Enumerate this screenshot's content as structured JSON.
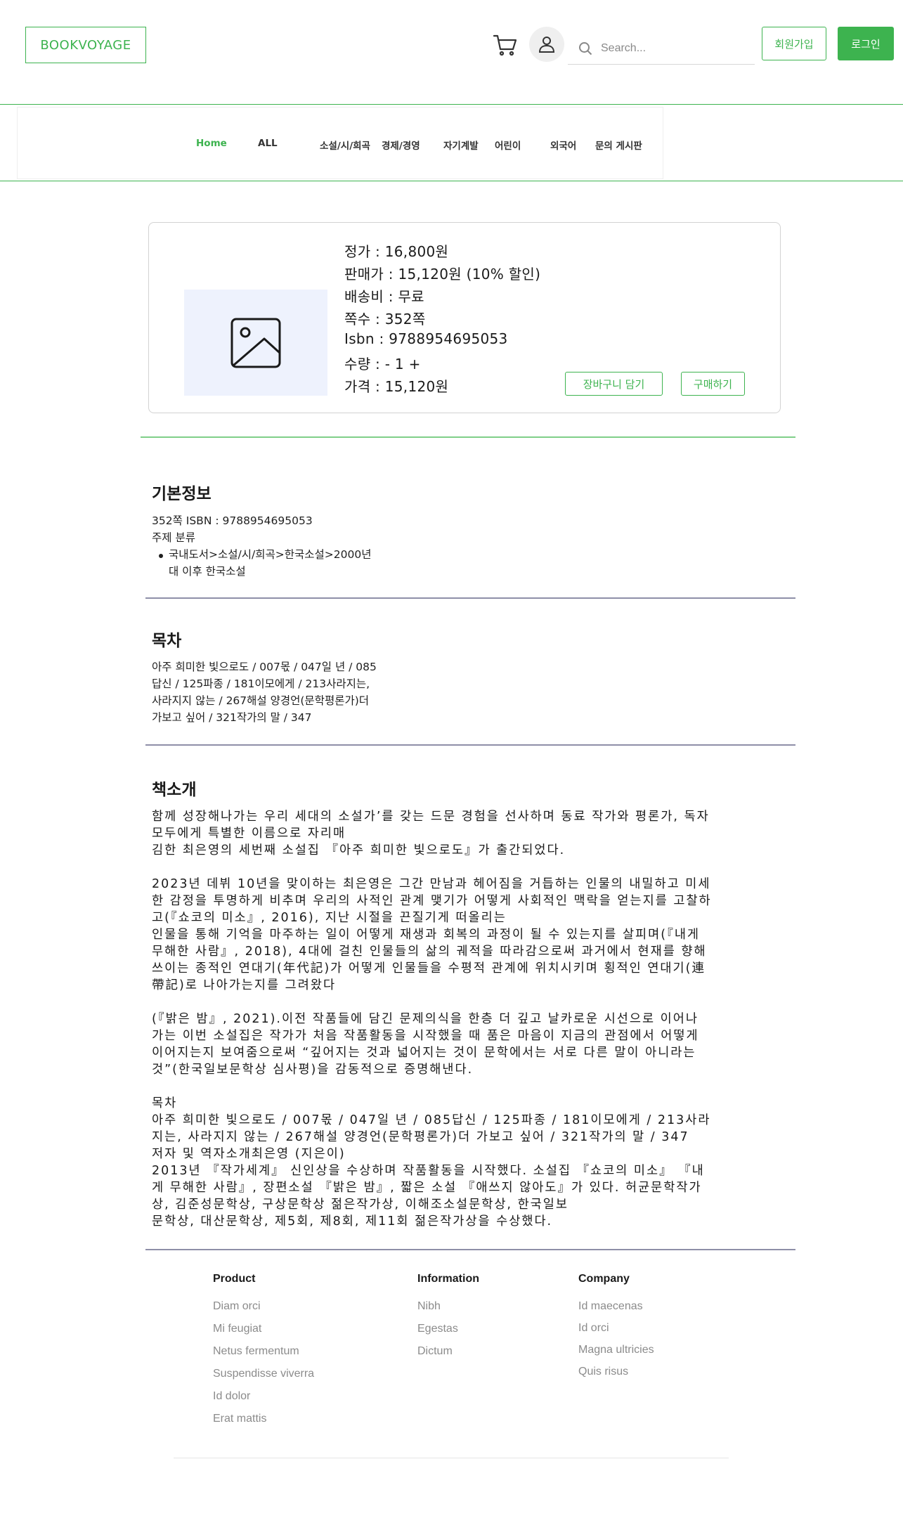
{
  "header": {
    "logo": "BOOKVOYAGE",
    "search_placeholder": "Search...",
    "signup_label": "회원가입",
    "login_label": "로그인",
    "accent": "#3db34f"
  },
  "nav": {
    "items": [
      "Home",
      "ALL",
      "소설/시/희곡",
      "경제/경영",
      "자기계발",
      "어린이",
      "외국어",
      "문의 게시판"
    ]
  },
  "product": {
    "lines": [
      "정가 : 16,800원",
      "판매가 : 15,120원 (10% 할인)",
      "배송비 : 무료",
      "쪽수 : 352쪽",
      "Isbn : 9788954695053",
      "수량 : - 1 +",
      "가격 : 15,120원"
    ],
    "add_to_cart_label": "장바구니 담기",
    "buy_label": "구매하기"
  },
  "basic_info": {
    "title": "기본정보",
    "line1": "352쪽 ISBN : 9788954695053",
    "line2": "주제 분류",
    "category_line1": "국내도서>소설/시/희곡>한국소설>2000년",
    "category_line2": "대 이후 한국소설"
  },
  "toc": {
    "title": "목차",
    "lines": [
      "아주 희미한 빛으로도 / 007몫 / 047일 년 / 085",
      "답신 / 125파종 / 181이모에게 / 213사라지는,",
      "사라지지 않는 / 267해설   양경언(문학평론가)더",
      "가보고 싶어 / 321작가의 말 / 347"
    ]
  },
  "intro": {
    "title": "책소개",
    "lines": [
      "함께 성장해나가는 우리 세대의 소설가’를 갖는 드문 경험을 선사하며 동료 작가와 평론가, 독자",
      "모두에게 특별한 이름으로 자리매",
      "김한 최은영의 세번째 소설집 『아주 희미한 빛으로도』가 출간되었다.",
      "",
      "2023년 데뷔 10년을 맞이하는 최은영은 그간 만남과 헤어짐을 거듭하는 인물의 내밀하고 미세",
      "한 감정을 투명하게 비추며 우리의 사적인 관계 맺기가 어떻게 사회적인 맥락을 얻는지를 고찰하",
      "고(『쇼코의 미소』, 2016), 지난 시절을 끈질기게 떠올리는",
      "인물을 통해 기억을 마주하는 일이 어떻게 재생과 회복의 과정이 될 수 있는지를 살피며(『내게",
      "무해한 사람』, 2018), 4대에 걸친 인물들의 삶의 궤적을 따라감으로써 과거에서 현재를 향해",
      "쓰이는 종적인 연대기(年代記)가 어떻게 인물들을 수평적 관계에 위치시키며 횡적인 연대기(連",
      "帶記)로 나아가는지를 그려왔다",
      "",
      "(『밝은 밤』, 2021).이전 작품들에 담긴 문제의식을 한층 더 깊고 날카로운 시선으로 이어나",
      "가는 이번 소설집은 작가가 처음 작품활동을 시작했을 때 품은 마음이 지금의 관점에서 어떻게",
      "이어지는지 보여줌으로써 “깊어지는 것과 넓어지는 것이 문학에서는 서로 다른 말이 아니라는",
      "것”(한국일보문학상 심사평)을 감동적으로 증명해낸다.",
      "",
      "목차",
      "아주 희미한 빛으로도 / 007몫 / 047일 년 / 085답신 / 125파종 / 181이모에게 / 213사라",
      "지는, 사라지지 않는 / 267해설   양경언(문학평론가)더 가보고 싶어 / 321작가의 말 / 347",
      "저자 및 역자소개최은영 (지은이)",
      "2013년 『작가세계』 신인상을 수상하며 작품활동을 시작했다. 소설집 『쇼코의 미소』 『내",
      "게 무해한 사람』, 장편소설 『밝은 밤』, 짧은 소설 『애쓰지 않아도』가 있다. 허균문학작가",
      "상, 김준성문학상, 구상문학상 젊은작가상, 이해조소설문학상, 한국일보",
      "문학상, 대산문학상, 제5회, 제8회, 제11회 젊은작가상을 수상했다."
    ]
  },
  "footer": {
    "columns": [
      {
        "title": "Product",
        "links": [
          "Diam orci",
          "Mi feugiat",
          "Netus fermentum",
          "Suspendisse viverra",
          "Id dolor",
          "Erat mattis"
        ]
      },
      {
        "title": "Information",
        "links": [
          "Nibh",
          "Egestas",
          "Dictum"
        ]
      },
      {
        "title": "Company",
        "links": [
          "Id maecenas",
          "Id orci",
          "Magna ultricies",
          "Quis risus"
        ]
      }
    ]
  }
}
